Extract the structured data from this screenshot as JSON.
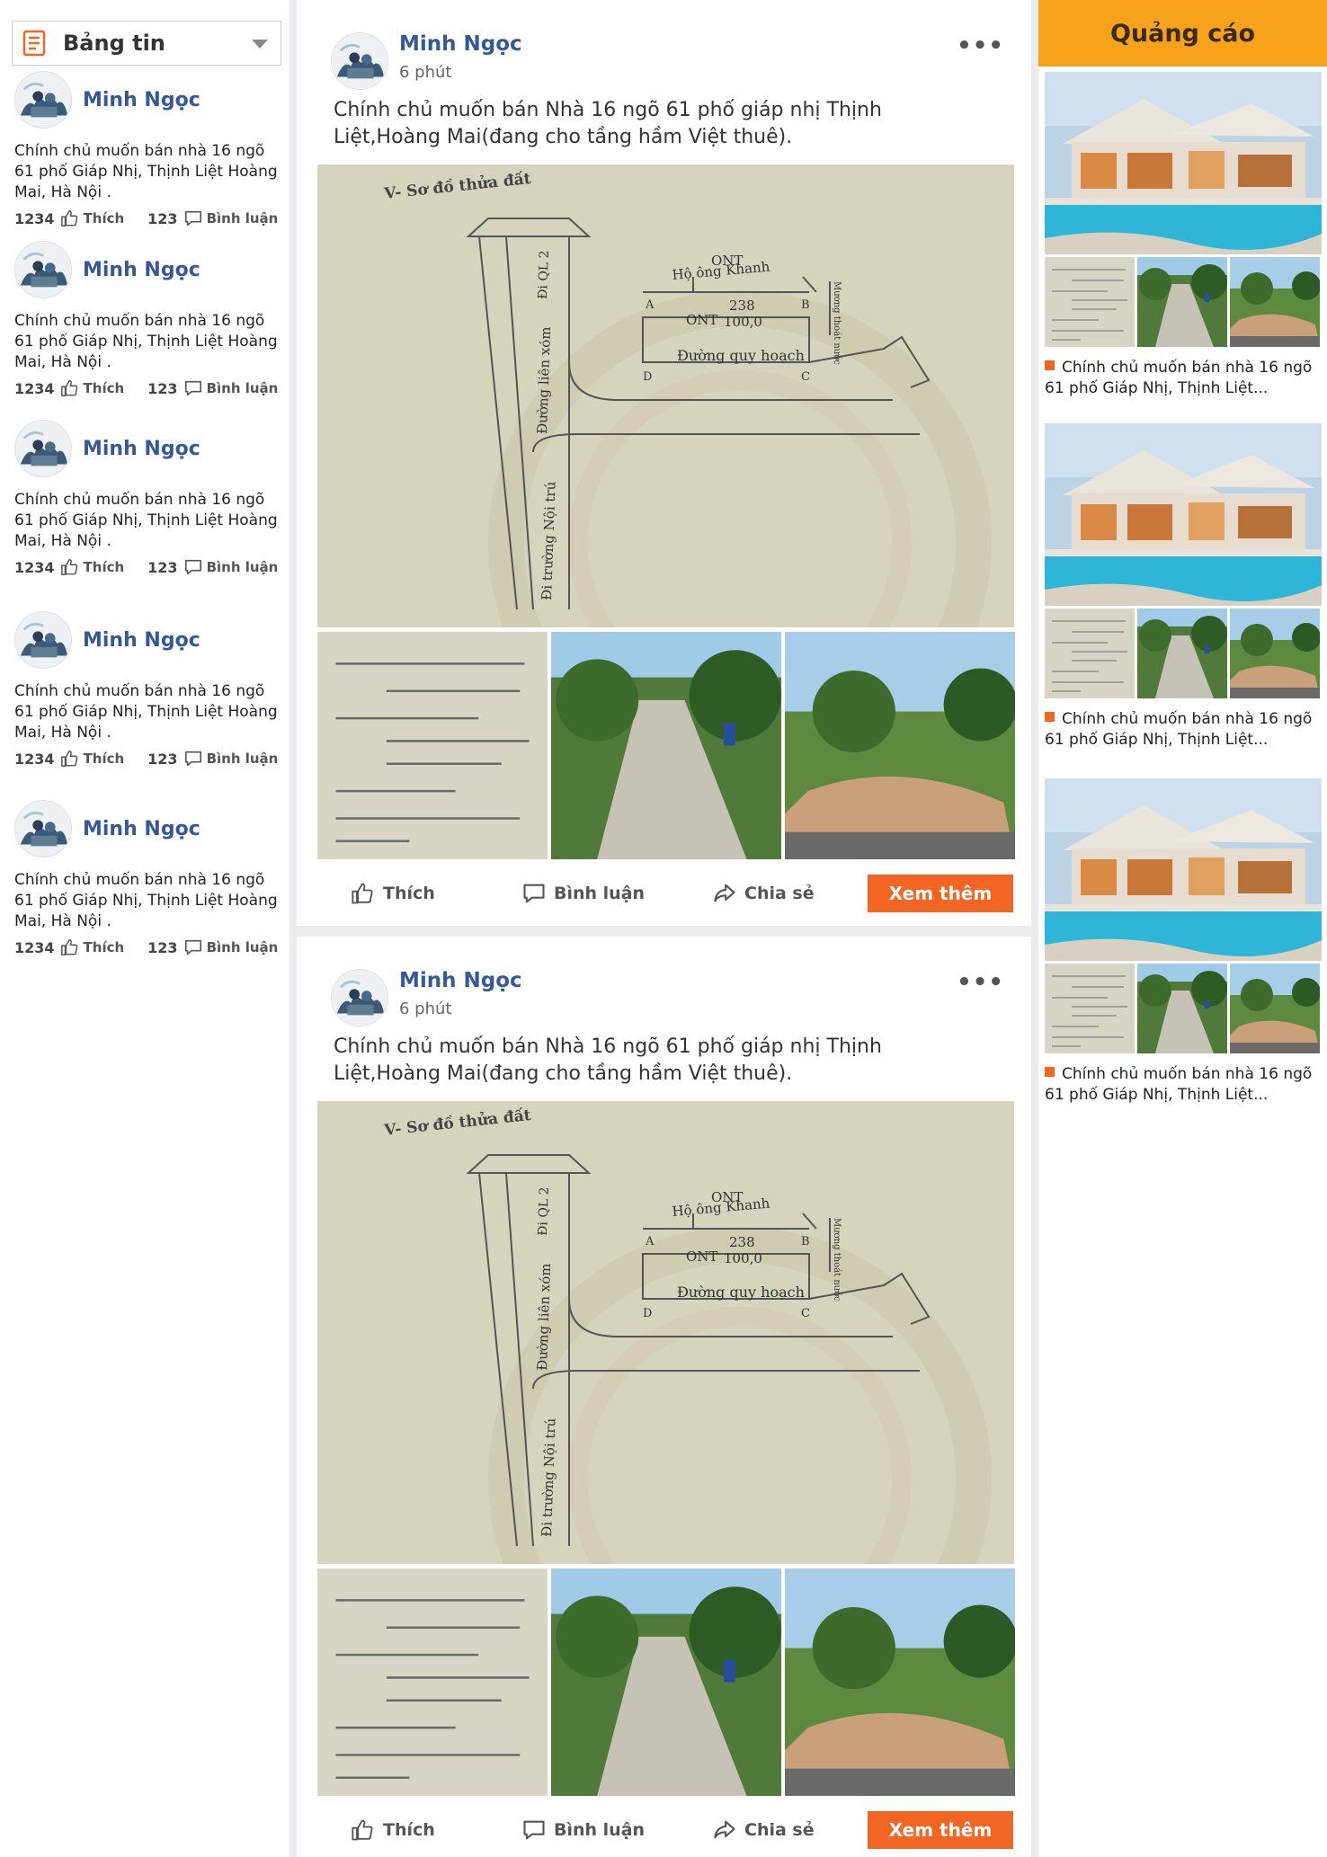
{
  "sidebar": {
    "feed_label": "Bảng tin",
    "items": [
      {
        "name": "Minh Ngọc",
        "text": "Chính chủ muốn bán nhà 16 ngõ 61 phố Giáp Nhị, Thịnh Liệt Hoàng Mai, Hà Nội .",
        "likes": "1234",
        "like_label": "Thích",
        "comments": "123",
        "comment_label": "Bình luận"
      },
      {
        "name": "Minh Ngọc",
        "text": "Chính chủ muốn bán nhà 16 ngõ 61 phố Giáp Nhị, Thịnh Liệt Hoàng Mai, Hà Nội .",
        "likes": "1234",
        "like_label": "Thích",
        "comments": "123",
        "comment_label": "Bình luận"
      },
      {
        "name": "Minh Ngọc",
        "text": "Chính chủ muốn bán nhà 16 ngõ 61 phố Giáp Nhị, Thịnh Liệt Hoàng Mai, Hà Nội .",
        "likes": "1234",
        "like_label": "Thích",
        "comments": "123",
        "comment_label": "Bình luận"
      },
      {
        "name": "Minh Ngọc",
        "text": "Chính chủ muốn bán nhà 16 ngõ 61 phố Giáp Nhị, Thịnh Liệt Hoàng Mai, Hà Nội .",
        "likes": "1234",
        "like_label": "Thích",
        "comments": "123",
        "comment_label": "Bình luận"
      },
      {
        "name": "Minh Ngọc",
        "text": "Chính chủ muốn bán nhà 16 ngõ 61 phố Giáp Nhị, Thịnh Liệt Hoàng Mai, Hà Nội .",
        "likes": "1234",
        "like_label": "Thích",
        "comments": "123",
        "comment_label": "Bình luận"
      }
    ]
  },
  "posts": [
    {
      "author": "Minh Ngọc",
      "time": "6 phút",
      "more": "•••",
      "text": "Chính chủ muốn bán Nhà 16 ngõ 61 phố giáp nhị Thịnh Liệt,Hoàng Mai(đang cho tầng hầm Việt thuê).",
      "like_label": "Thích",
      "comment_label": "Bình luận",
      "share_label": "Chia sẻ",
      "see_more_label": "Xem thêm"
    },
    {
      "author": "Minh Ngọc",
      "time": "6 phút",
      "more": "•••",
      "text": "Chính chủ muốn bán Nhà 16 ngõ 61 phố giáp nhị Thịnh Liệt,Hoàng Mai(đang cho tầng hầm Việt thuê).",
      "like_label": "Thích",
      "comment_label": "Bình luận",
      "share_label": "Chia sẻ",
      "see_more_label": "Xem thêm"
    }
  ],
  "map_image": {
    "heading": "V- Sơ đồ thửa đất",
    "road_top": "Đi QL 2",
    "owner_code": "ONT",
    "owner_name": "Hộ ông Khanh",
    "parcel_no": "238",
    "parcel_code": "ONT",
    "parcel_area": "100,0",
    "planned_road": "Đường quy hoạch",
    "lane": "Đường liên xóm",
    "school_road": "Đi trường Nội trú",
    "ditch": "Mương thoát nước",
    "corner_a": "A",
    "corner_b": "B",
    "corner_c": "C",
    "corner_d": "D"
  },
  "ads": {
    "header": "Quảng cáo",
    "items": [
      {
        "text": "Chính chủ muốn bán nhà 16 ngõ 61 phố Giáp Nhị, Thịnh Liệt..."
      },
      {
        "text": "Chính chủ muốn bán nhà 16 ngõ 61 phố Giáp Nhị, Thịnh Liệt..."
      },
      {
        "text": "Chính chủ muốn bán nhà 16 ngõ 61 phố Giáp Nhị, Thịnh Liệt..."
      }
    ]
  },
  "colors": {
    "name_blue": "#365899",
    "accent_orange": "#f26522",
    "ads_header": "#f7a21b"
  },
  "icons": [
    "newsfeed-icon",
    "chevron-down-icon",
    "like-icon",
    "comment-icon",
    "share-icon",
    "more-icon"
  ]
}
